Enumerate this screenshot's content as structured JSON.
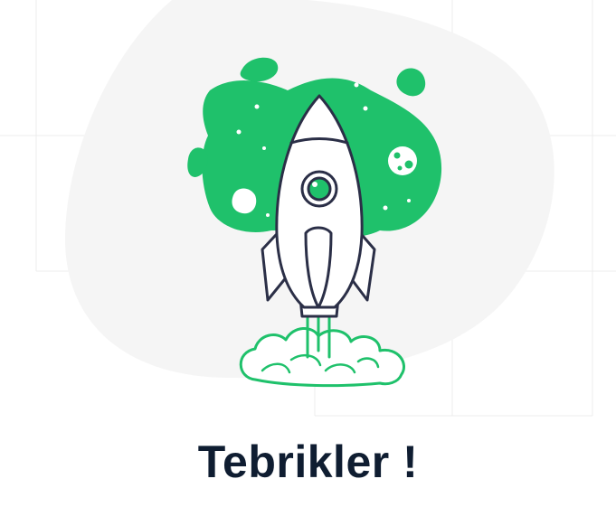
{
  "success": {
    "title": "Tebrikler !"
  },
  "colors": {
    "accent": "#1fc16b",
    "outline": "#2b2f47",
    "blob": "#f5f5f5",
    "title": "#0f1d31",
    "grid": "#ececec"
  },
  "icons": {
    "illustration": "rocket-launch-icon"
  }
}
